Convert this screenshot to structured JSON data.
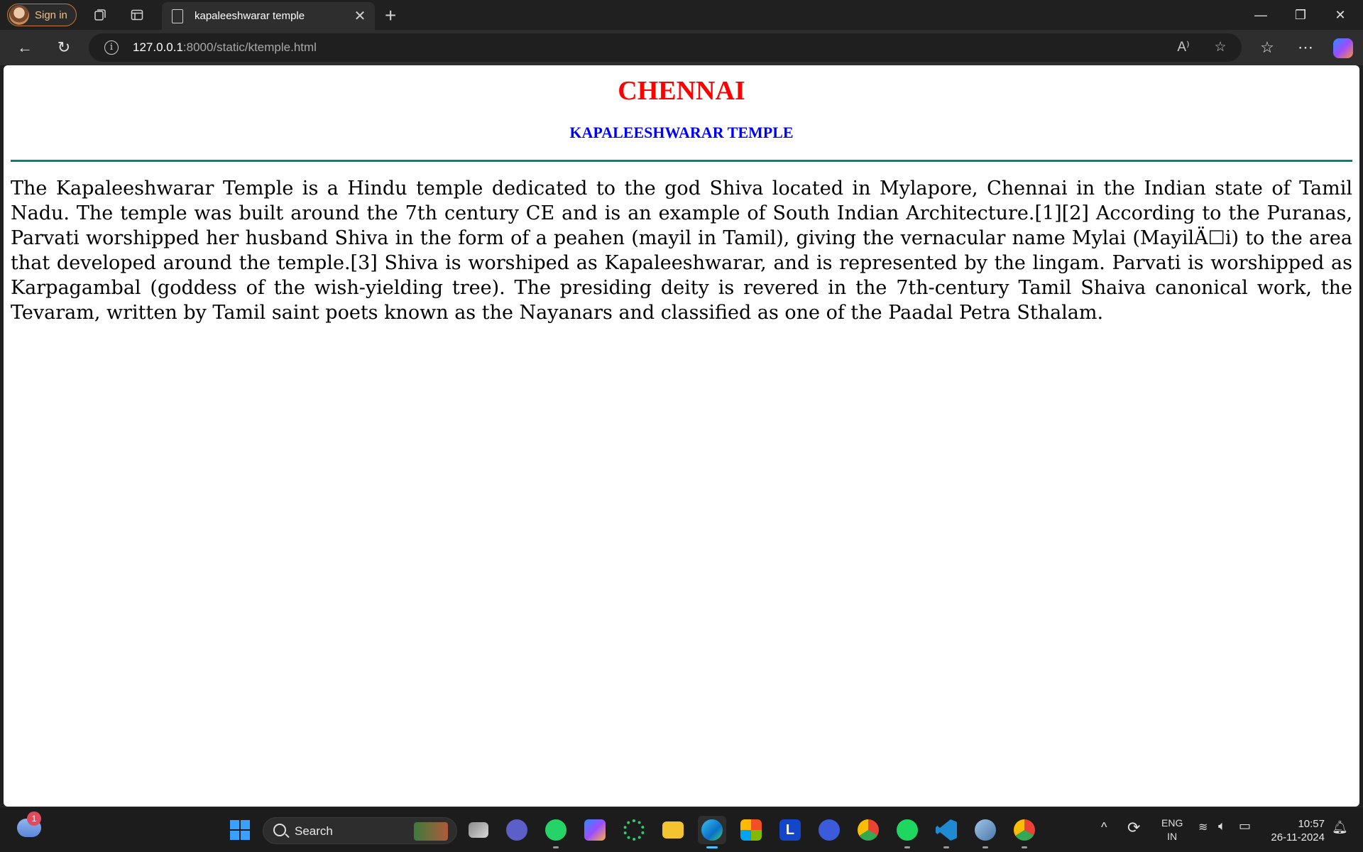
{
  "browser": {
    "signin_label": "Sign in",
    "tab_title": "kapaleeshwarar temple",
    "url_host": "127.0.0.1",
    "url_rest": ":8000/static/ktemple.html"
  },
  "page": {
    "heading": "CHENNAI",
    "subheading": "KAPALEESHWARAR TEMPLE",
    "paragraph": "The Kapaleeshwarar Temple is a Hindu temple dedicated to the god Shiva located in Mylapore, Chennai in the Indian state of Tamil Nadu. The temple was built around the 7th century CE and is an example of South Indian Architecture.[1][2] According to the Puranas, Parvati worshipped her husband Shiva in the form of a peahen (mayil in Tamil), giving the vernacular name Mylai (MayilÄ☐i) to the area that developed around the temple.[3] Shiva is worshiped as Kapaleeshwarar, and is represented by the lingam. Parvati is worshipped as Karpagambal (goddess of the wish-yielding tree). The presiding deity is revered in the 7th-century Tamil Shaiva canonical work, the Tevaram, written by Tamil saint poets known as the Nayanars and classified as one of the Paadal Petra Sthalam."
  },
  "taskbar": {
    "weather_badge": "1",
    "search_label": "Search",
    "lang_top": "ENG",
    "lang_bottom": "IN",
    "time": "10:57",
    "date": "26-11-2024"
  }
}
